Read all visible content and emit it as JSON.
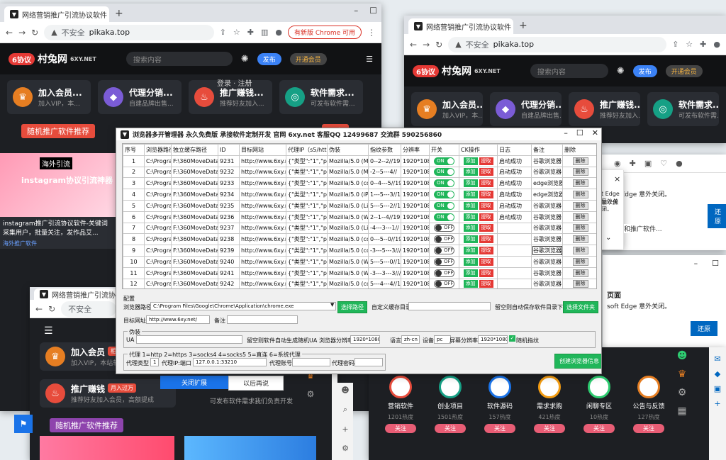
{
  "browser": {
    "tab_title": "网络营销推广引流协议软件 | 6协...",
    "tab_title2": "网络营销推广引流协议软件 | 6协...",
    "not_secure": "不安全",
    "url": "pikaka.top",
    "update_label": "有新版 Chrome 可用"
  },
  "site": {
    "logo_badge": "6协议",
    "logo_text": "村兔网",
    "logo_sub": "6XY.NET",
    "search_placeholder": "搜索内容",
    "publish": "发布",
    "vip": "开通会员",
    "login": "登录 · 注册",
    "more": "更多",
    "recommend": "随机推广软件推荐",
    "cards": [
      {
        "title": "加入会员...",
        "sub": "加入VIP，本...",
        "color": "#e67e22",
        "icon": "♛"
      },
      {
        "title": "代理分销...",
        "sub": "自建品牌出售...",
        "color": "#7b5cd6",
        "icon": "◆"
      },
      {
        "title": "推广赚钱...",
        "sub": "推荐好友加入...",
        "color": "#e74c3c",
        "icon": "♨"
      },
      {
        "title": "软件需求...",
        "sub": "可发布软件需...",
        "color": "#16a085",
        "icon": "◎"
      }
    ],
    "post_title": "instagram推广引流协议软件-关键词采集用户，批量关注，发作品艾...",
    "post_tag": "海外推广软件",
    "post_banner": "海外引流",
    "post_banner2": "instagram协议引流神器",
    "bottom_cards": [
      {
        "title": "加入会员",
        "badge": "相对优惠",
        "sub": "加入VIP，本站软件..."
      },
      {
        "title": "推广赚钱",
        "badge": "月入过万",
        "sub": "推荐好友加入会员，高额提成"
      }
    ],
    "bottom_more": "可发布软件需求我们负责开发",
    "collapse": "关闭扩展",
    "later": "以后再说"
  },
  "categories": [
    {
      "name": "营销软件",
      "heat": "1201热度",
      "btn": "关注"
    },
    {
      "name": "创业项目",
      "heat": "1501热度",
      "btn": "关注"
    },
    {
      "name": "软件源码",
      "heat": "157热度",
      "btn": "关注"
    },
    {
      "name": "需求求购",
      "heat": "421热度",
      "btn": "关注"
    },
    {
      "name": "闲聊专区",
      "heat": "10热度",
      "btn": "关注"
    },
    {
      "name": "公告与反馈",
      "heat": "127热度",
      "btn": "关注"
    }
  ],
  "edge": {
    "crash_msg": "soft Edge 意外关闭。",
    "crash_msg2": "soft Edge 意外关闭。",
    "page_label": "页面",
    "page_label2": "页面",
    "restore": "还原",
    "restore2": "还原",
    "side_text": "t Edge 意外关闭。",
    "side_text2": "加以保",
    "hint": "和推广软件..."
  },
  "app": {
    "title": "浏览器多开管理器  永久免费版 承接软件定制开发 官网 6xy.net 客服QQ 12499687 交流群 590256860",
    "headers": [
      "序号",
      "浏览器路径",
      "独立缓存路径",
      "ID",
      "目标网站",
      "代理IP（s5/https",
      "伪装",
      "指纹参数",
      "分辨率",
      "开关",
      "CK操作",
      "日志",
      "备注",
      "删除"
    ],
    "rows": [
      {
        "no": "1",
        "path": "C:\\Program",
        "cache": "F:\\360MoveData",
        "id": "9231",
        "site": "http://www.6xy.ne",
        "proxy": "{\"类型\":\"1\",\"prox",
        "ua": "Mozilla/5.0 (Mac",
        "fp": "0--2--2//19",
        "res": "1920*1080",
        "on": true,
        "log": "启动成功",
        "note": "谷歌浏览器"
      },
      {
        "no": "2",
        "path": "C:\\Program",
        "cache": "F:\\360MoveData",
        "id": "9232",
        "site": "http://www.6xy.ne",
        "proxy": "{\"类型\":\"1\",\"prox",
        "ua": "Mozilla/5.0 (Mac",
        "fp": "-2--5---4//",
        "res": "1920*1080",
        "on": true,
        "log": "启动成功",
        "note": "谷歌浏览器"
      },
      {
        "no": "3",
        "path": "C:\\Program",
        "cache": "F:\\360MoveData",
        "id": "9233",
        "site": "http://www.6xy.ne",
        "proxy": "{\"类型\":\"1\",\"prox",
        "ua": "Mozilla/5.0 (con",
        "fp": "0--4---5//19",
        "res": "1920*1080",
        "on": true,
        "log": "启动成功",
        "note": "edge浏览器"
      },
      {
        "no": "4",
        "path": "C:\\Program",
        "cache": "F:\\360MoveData",
        "id": "9234",
        "site": "http://www.6xy.ne",
        "proxy": "{\"类型\":\"1\",\"prox",
        "ua": "Mozilla/5.0 (iPoc",
        "fp": "1---5---3//1",
        "res": "1920*1080",
        "on": true,
        "log": "启动成功",
        "note": "edge浏览器"
      },
      {
        "no": "5",
        "path": "C:\\Program",
        "cache": "F:\\360MoveData",
        "id": "9235",
        "site": "http://www.6xy.ne",
        "proxy": "{\"类型\":\"1\",\"prox",
        "ua": "Mozilla/5.0 (Lin,",
        "fp": "5---5---2//1",
        "res": "1920*1080",
        "on": true,
        "log": "启动成功",
        "note": "谷歌浏览器"
      },
      {
        "no": "6",
        "path": "C:\\Program",
        "cache": "F:\\360MoveData",
        "id": "9236",
        "site": "http://www.6xy.ne",
        "proxy": "{\"类型\":\"1\",\"prox",
        "ua": "Mozilla/5.0 (Win",
        "fp": "2--1--4//19",
        "res": "1920*1080",
        "on": true,
        "log": "启动成功",
        "note": "谷歌浏览器"
      },
      {
        "no": "7",
        "path": "C:\\Program",
        "cache": "F:\\360MoveData",
        "id": "9237",
        "site": "http://www.6xy.ne",
        "proxy": "{\"类型\":\"1\",\"prox",
        "ua": "Mozilla/5.0 (Linu",
        "fp": "-4---3---1//",
        "res": "1920*1080",
        "on": false,
        "log": "",
        "note": "谷歌浏览器"
      },
      {
        "no": "8",
        "path": "C:\\Program",
        "cache": "F:\\360MoveData",
        "id": "9238",
        "site": "http://www.6xy.ne",
        "proxy": "{\"类型\":\"1\",\"prox",
        "ua": "Mozilla/5.0 (con",
        "fp": "0---5--0//19",
        "res": "1920*1080",
        "on": false,
        "log": "",
        "note": "谷歌浏览器"
      },
      {
        "no": "9",
        "path": "C:\\Program",
        "cache": "F:\\360MoveData",
        "id": "9239",
        "site": "http://www.6xy.ne",
        "proxy": "{\"类型\":\"1\",\"prox",
        "ua": "Mozilla/5.0 (con",
        "fp": "-3---5---3///1",
        "res": "1920*1080",
        "on": false,
        "log": "",
        "note": "谷歌浏览器"
      },
      {
        "no": "10",
        "path": "C:\\Program",
        "cache": "F:\\360MoveData",
        "id": "9240",
        "site": "http://www.6xy.ne",
        "proxy": "{\"类型\":\"1\",\"prox",
        "ua": "Mozilla/5.0 (Win",
        "fp": "5---5---0//1",
        "res": "1920*1080",
        "on": false,
        "log": "",
        "note": "谷歌浏览器"
      },
      {
        "no": "11",
        "path": "C:\\Program",
        "cache": "F:\\360MoveData",
        "id": "9241",
        "site": "http://www.6xy.ne",
        "proxy": "{\"类型\":\"1\",\"prox",
        "ua": "Mozilla/5.0 (Win",
        "fp": "-3---3---3///1",
        "res": "1920*1080",
        "on": false,
        "log": "",
        "note": "谷歌浏览器"
      },
      {
        "no": "12",
        "path": "C:\\Program",
        "cache": "F:\\360MoveData",
        "id": "9242",
        "site": "http://www.6xy.ne",
        "proxy": "{\"类型\":\"1\",\"prox",
        "ua": "Mozilla/5.0 (con",
        "fp": "5---4---4//1",
        "res": "1920*1080",
        "on": false,
        "log": "",
        "note": "谷歌浏览器"
      }
    ],
    "btn_add": "添加",
    "btn_extract": "提取",
    "btn_delete": "删除",
    "toggle_on": "ON",
    "toggle_off": "OFF",
    "config": {
      "section": "配置",
      "browser_path_label": "浏览器路径",
      "browser_path": "C:\\Program Files\\Google\\Chrome\\Application\\chrome.exe",
      "select_path": "选择路径",
      "custom_cache": "自定义缓存目录",
      "auto_cache": "留空则自动保存软件目录下",
      "select_folder": "选择文件夹",
      "target_label": "目标网址",
      "target_url": "http://www.6xy.net/",
      "note_label": "备注",
      "disguise": "伪装",
      "ua_label": "UA",
      "auto_ua": "留空则软件自动生成随机UA",
      "res_label": "浏览器分辨率",
      "res_value": "1920*1080",
      "lang_label": "语言",
      "lang_value": "zh-cn",
      "device_label": "设备",
      "device_value": "pc",
      "screen_label": "屏幕分辨率",
      "screen_value": "1920*1080",
      "random_fp": "随机指纹",
      "proxy_section": "代理  1=http 2=https 3=socks4 4=socks5 5=直连 6=系统代理",
      "proxy_type_label": "代理类型",
      "proxy_type": "1",
      "proxy_ip_label": "代理IP:端口",
      "proxy_ip": "127.0.0.1:33210",
      "proxy_user": "代理账号",
      "proxy_pass": "代理密码",
      "create": "创建浏览器信息"
    }
  }
}
